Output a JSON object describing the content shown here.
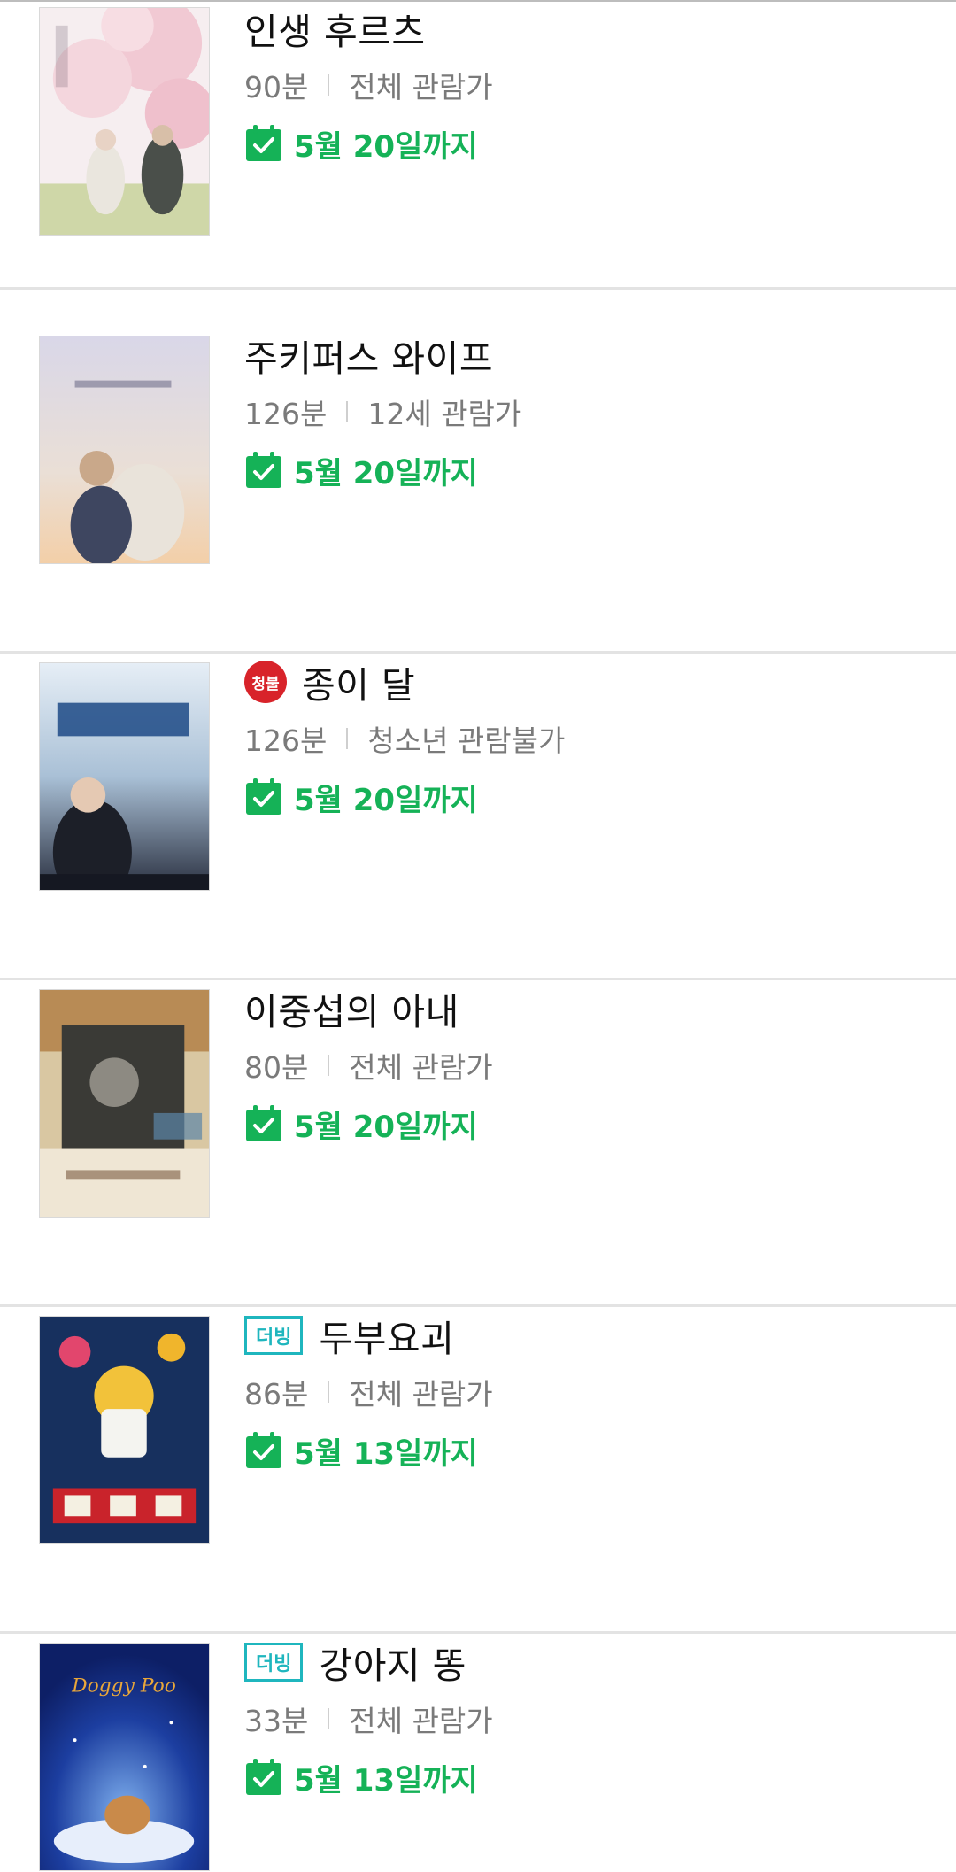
{
  "colors": {
    "accent_green": "#15b257",
    "rating_red": "#d8232a",
    "dub_teal": "#1fb6be",
    "meta_gray": "#7a7a7a"
  },
  "icons": {
    "calendar": "calendar-check-icon"
  },
  "movies": [
    {
      "title": "인생 후르츠",
      "badge": null,
      "runtime": "90분",
      "rating": "전체 관람가",
      "until": "5월 20일까지"
    },
    {
      "title": "주키퍼스 와이프",
      "badge": null,
      "runtime": "126분",
      "rating": "12세 관람가",
      "until": "5월 20일까지"
    },
    {
      "title": "종이 달",
      "badge": "청불",
      "runtime": "126분",
      "rating": "청소년 관람불가",
      "until": "5월 20일까지"
    },
    {
      "title": "이중섭의 아내",
      "badge": null,
      "runtime": "80분",
      "rating": "전체 관람가",
      "until": "5월 20일까지"
    },
    {
      "title": "두부요괴",
      "badge": "더빙",
      "runtime": "86분",
      "rating": "전체 관람가",
      "until": "5월 13일까지"
    },
    {
      "title": "강아지 똥",
      "badge": "더빙",
      "runtime": "33분",
      "rating": "전체 관람가",
      "until": "5월 13일까지"
    }
  ],
  "poster_texts": {
    "doggy_poo": "Doggy Poo"
  }
}
